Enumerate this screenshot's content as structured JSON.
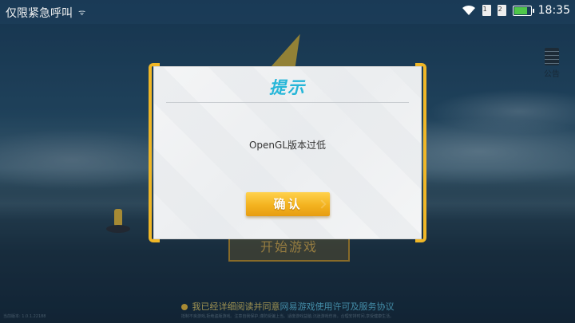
{
  "status_bar": {
    "carrier_text": "仅限紧急呼叫",
    "time": "18:35",
    "battery_level": 0.8,
    "icons": [
      "signal-small-icon",
      "wifi-icon",
      "sim-card-1-icon",
      "sim-card-2-icon",
      "battery-icon"
    ]
  },
  "background": {
    "notice_label": "公告",
    "start_button_label": "开始游戏",
    "agreement_prefix": "我已经详细阅读并同意",
    "agreement_link": "网易游戏使用许可及服务协议",
    "legal_text": "抵制不良游戏,拒绝盗版游戏。注意自我保护,谨防受骗上当。适度游戏益脑,沉迷游戏伤身。合理安排时间,享受健康生活。",
    "version_text": "当前版本: 1.0.1.22188"
  },
  "dialog": {
    "title": "提示",
    "message": "OpenGL版本过低",
    "confirm_label": "确认"
  },
  "colors": {
    "dialog_title": "#26b6d8",
    "bracket": "#f0b727",
    "confirm_button": "#f3b21f",
    "agreement_link": "#59b9d9"
  }
}
